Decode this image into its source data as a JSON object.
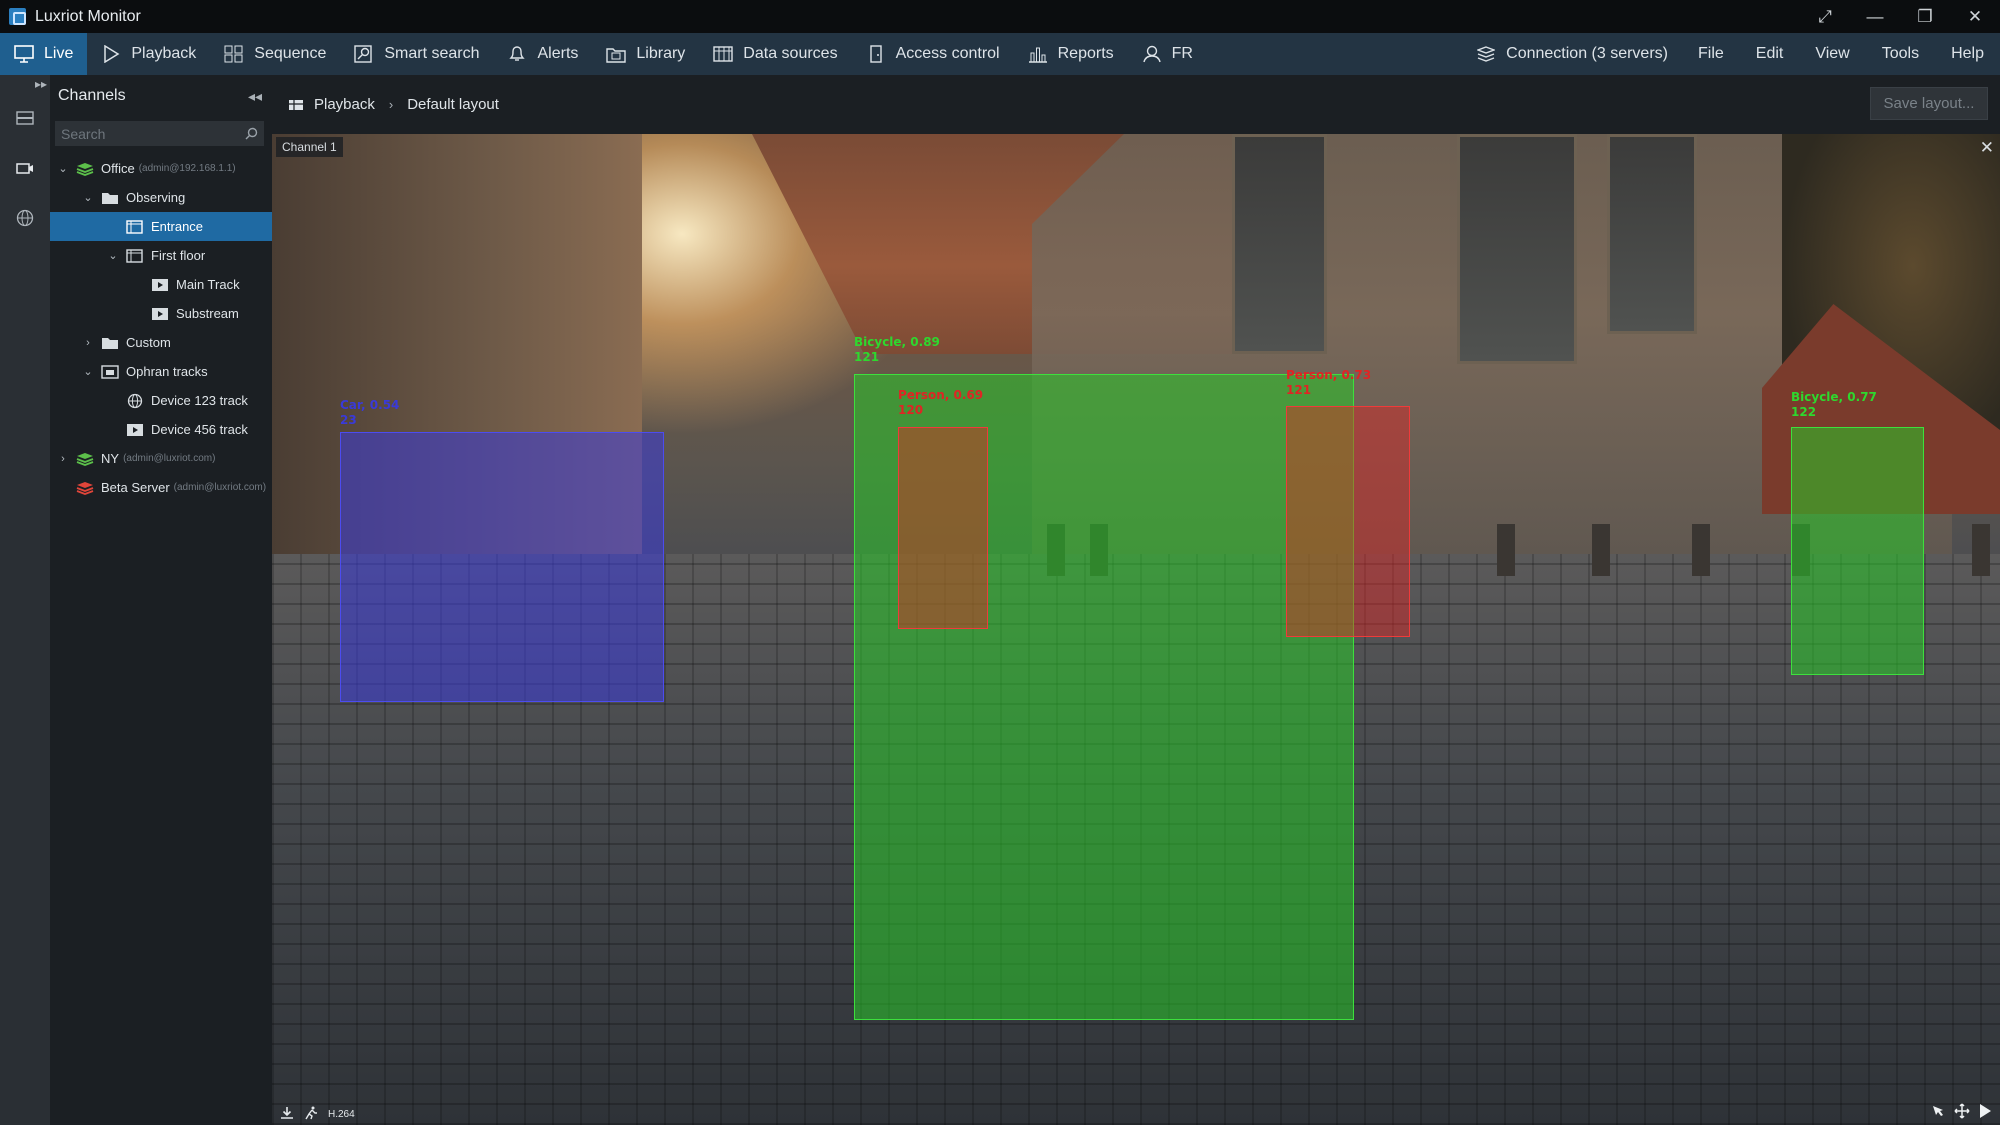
{
  "app": {
    "title": "Luxriot Monitor"
  },
  "toolbar": {
    "items": [
      {
        "label": "Live",
        "icon": "monitor-icon"
      },
      {
        "label": "Playback",
        "icon": "play-icon"
      },
      {
        "label": "Sequence",
        "icon": "grid-icon"
      },
      {
        "label": "Smart search",
        "icon": "smart-search-icon"
      },
      {
        "label": "Alerts",
        "icon": "bell-icon"
      },
      {
        "label": "Library",
        "icon": "library-icon"
      },
      {
        "label": "Data sources",
        "icon": "data-sources-icon"
      },
      {
        "label": "Access control",
        "icon": "door-icon"
      },
      {
        "label": "Reports",
        "icon": "bar-chart-icon"
      },
      {
        "label": "FR",
        "icon": "face-icon"
      }
    ],
    "connection": "Connection (3 servers)",
    "menus": [
      "File",
      "Edit",
      "View",
      "Tools",
      "Help"
    ]
  },
  "channels": {
    "title": "Channels",
    "search_placeholder": "Search",
    "tree": [
      {
        "label": "Office",
        "sub": "(admin@192.168.1.1)"
      },
      {
        "label": "Observing"
      },
      {
        "label": "Entrance"
      },
      {
        "label": "First floor"
      },
      {
        "label": "Main Track"
      },
      {
        "label": "Substream"
      },
      {
        "label": "Custom"
      },
      {
        "label": "Ophran tracks"
      },
      {
        "label": "Device 123 track"
      },
      {
        "label": "Device 456 track"
      },
      {
        "label": "NY",
        "sub": "(admin@luxriot.com)"
      },
      {
        "label": "Beta Server",
        "sub": "(admin@luxriot.com)"
      }
    ]
  },
  "content": {
    "breadcrumb": [
      "Playback",
      "Default layout"
    ],
    "save_label": "Save layout..."
  },
  "video": {
    "channel_label": "Channel 1",
    "codec": "H.264",
    "detections": [
      {
        "label": "Car, 0.54",
        "id": "23",
        "color": "#3a3ad8"
      },
      {
        "label": "Bicycle, 0.89",
        "id": "121",
        "color": "#2ed82e"
      },
      {
        "label": "Person, 0.69",
        "id": "120",
        "color": "#e02424"
      },
      {
        "label": "Person, 0.73",
        "id": "121",
        "color": "#e02424"
      },
      {
        "label": "Bicycle, 0.77",
        "id": "122",
        "color": "#2ed82e"
      }
    ]
  },
  "colors": {
    "accent": "#1f6aa3",
    "toolbar": "#233443",
    "panel": "#1b1f23"
  }
}
